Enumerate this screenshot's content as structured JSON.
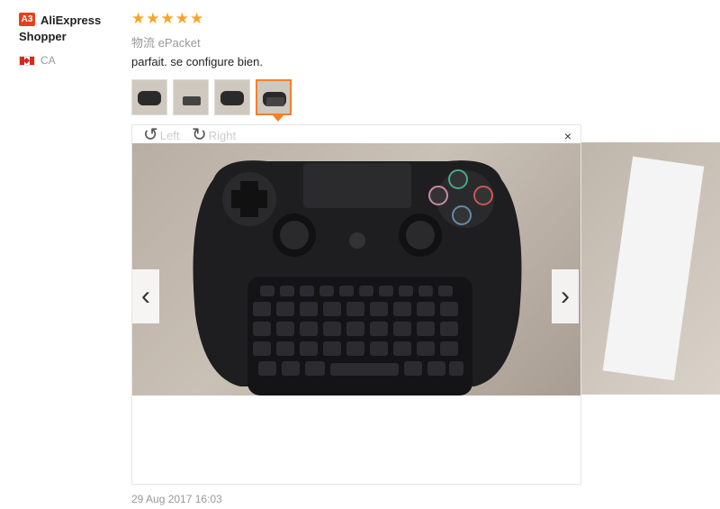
{
  "user": {
    "badge": "A3",
    "name": "AliExpress Shopper",
    "country": "CA"
  },
  "review": {
    "rating": 5,
    "stars": [
      "★",
      "★",
      "★",
      "★",
      "★"
    ],
    "shipping": "物流 ePacket",
    "text": "parfait. se configure bien.",
    "date": "29 Aug 2017 16:03"
  },
  "viewer": {
    "rotate_left": "Left",
    "rotate_right": "Right",
    "close": "×",
    "prev": "‹",
    "next": "›",
    "thumb_count": 4,
    "active_thumb": 4
  },
  "icons": {
    "rotate_left": "rotate-left-icon",
    "rotate_right": "rotate-right-icon",
    "close": "close-icon",
    "prev": "chevron-left-icon",
    "next": "chevron-right-icon"
  },
  "colors": {
    "accent": "#f3802a",
    "star": "#f5a623",
    "badge": "#e8401c"
  }
}
